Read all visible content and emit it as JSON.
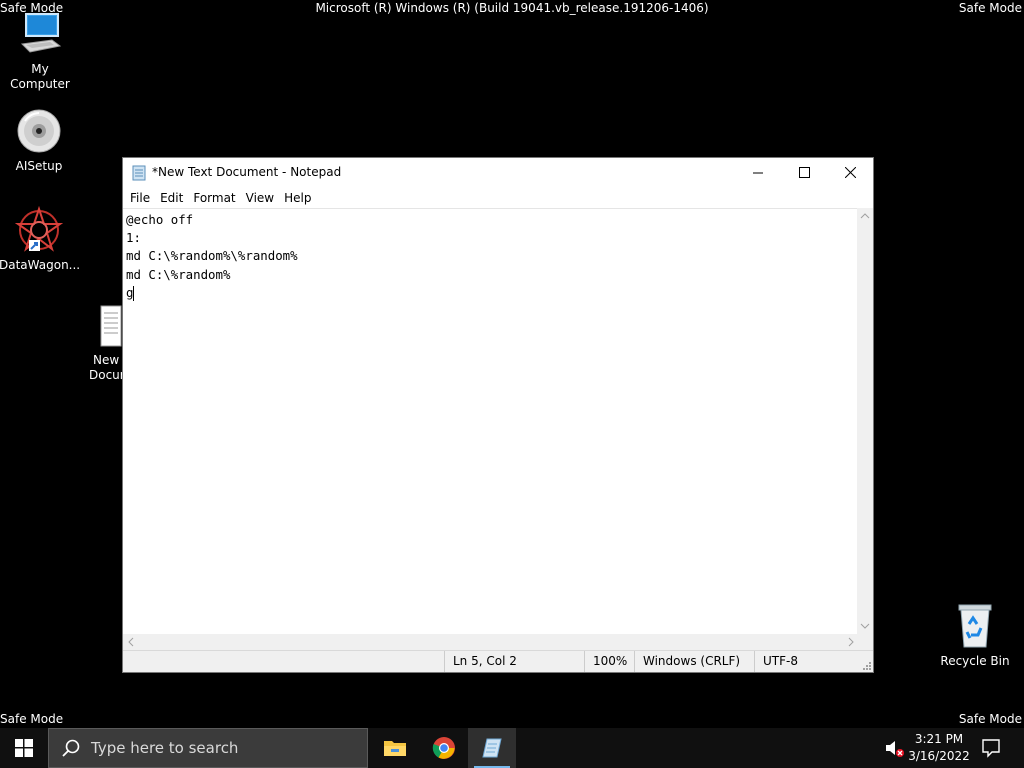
{
  "system": {
    "safe_mode_label": "Safe Mode",
    "build_title": "Microsoft (R) Windows (R) (Build 19041.vb_release.191206-1406)"
  },
  "desktop": {
    "icons": [
      {
        "label": "My Computer",
        "icon": "computer-icon"
      },
      {
        "label": "AISetup",
        "icon": "disc-icon"
      },
      {
        "label": "DataWagon...",
        "icon": "spiral-logo-icon"
      },
      {
        "label_line1": "New T",
        "label_line2": "Docur",
        "icon": "text-document-icon"
      },
      {
        "label": "Recycle Bin",
        "icon": "recycle-bin-icon"
      }
    ]
  },
  "notepad": {
    "title": "*New Text Document - Notepad",
    "menu": [
      "File",
      "Edit",
      "Format",
      "View",
      "Help"
    ],
    "lines": [
      "@echo off",
      "1:",
      "md C:\\%random%\\%random%",
      "md C:\\%random%",
      "g"
    ],
    "status": {
      "position": "Ln 5, Col 2",
      "zoom": "100%",
      "line_ending": "Windows (CRLF)",
      "encoding": "UTF-8"
    }
  },
  "taskbar": {
    "search_placeholder": "Type here to search",
    "apps": [
      "file-explorer-icon",
      "chrome-icon",
      "notepad-icon"
    ],
    "time": "3:21 PM",
    "date": "3/16/2022"
  },
  "colors": {
    "desktop_bg": "#000000",
    "taskbar_bg": "#101010",
    "active_indicator": "#76b9ed"
  }
}
